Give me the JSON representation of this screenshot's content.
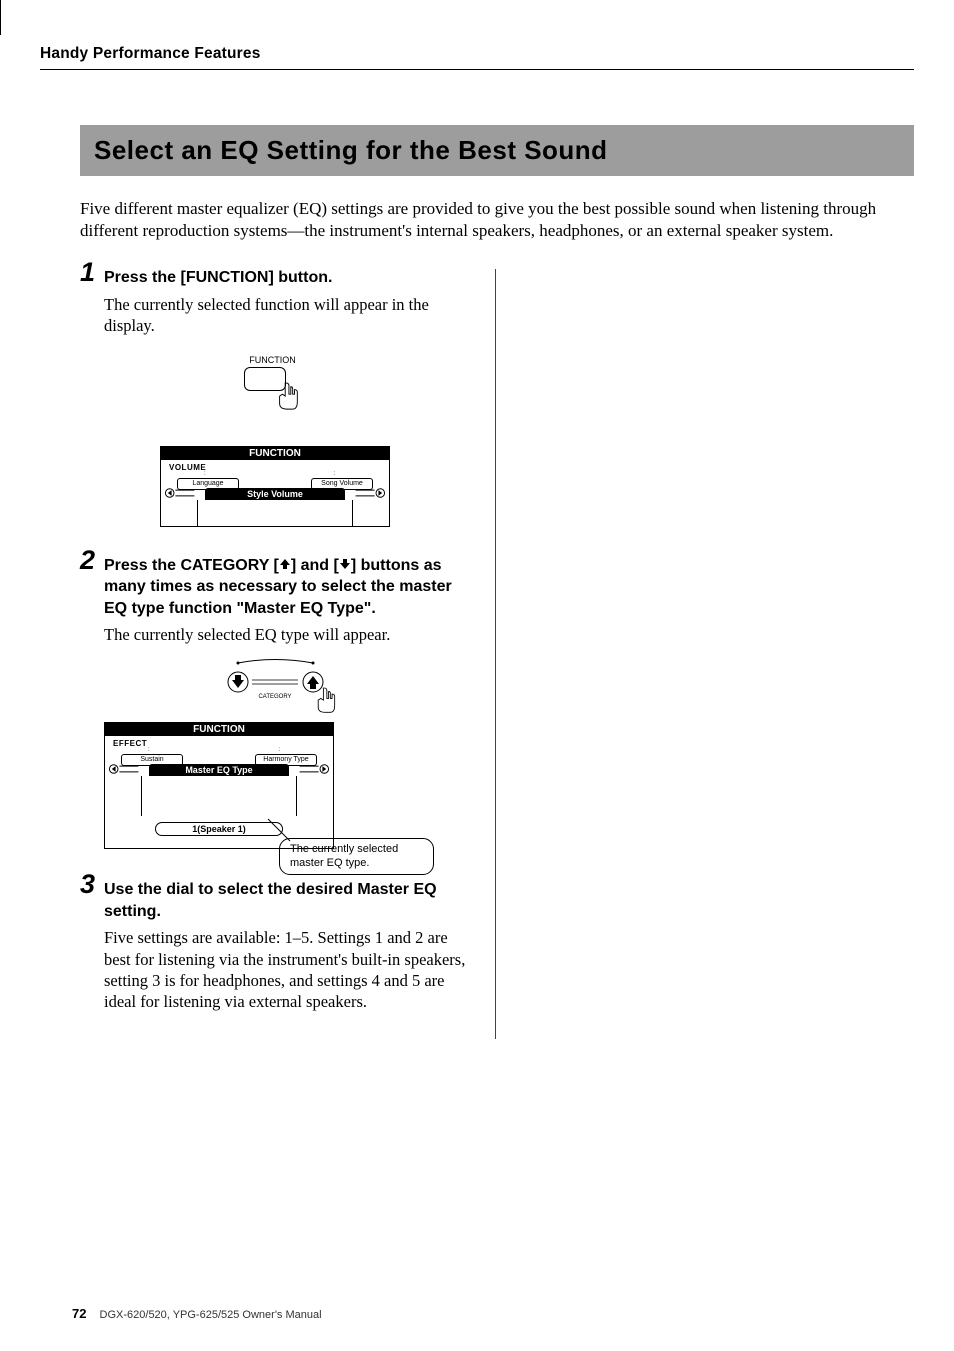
{
  "header": {
    "breadcrumb": "Handy Performance Features"
  },
  "section": {
    "title": "Select an EQ Setting for the Best Sound"
  },
  "intro": "Five different master equalizer (EQ) settings are provided to give you the best possible sound when listening through different reproduction systems—the instrument's internal speakers, headphones, or an external speaker system.",
  "steps": {
    "s1": {
      "num": "1",
      "head": "Press the [FUNCTION] button.",
      "body": "The currently selected function will appear in the display."
    },
    "s2": {
      "num": "2",
      "head_pre": "Press the CATEGORY [",
      "head_mid": "] and [",
      "head_post": "] buttons as many times as necessary to select the master EQ type function \"Master EQ Type\".",
      "body": "The currently selected EQ type will appear."
    },
    "s3": {
      "num": "3",
      "head": "Use the dial to select the desired Master EQ setting.",
      "body": "Five settings are available: 1–5. Settings 1 and 2 are best for listening via the instrument's built-in speakers, setting 3 is for headphones, and settings 4 and 5 are ideal for listening via external speakers."
    }
  },
  "fig1": {
    "func_label": "FUNCTION",
    "lcd_top": "FUNCTION",
    "lcd_title": "VOLUME",
    "chip_left": "Language",
    "chip_right": "Song Volume",
    "big_chip": "Style Volume"
  },
  "fig2": {
    "panel_label": "CATEGORY",
    "lcd_top": "FUNCTION",
    "lcd_title": "EFFECT",
    "chip_left": "Sustain",
    "chip_right": "Harmony Type",
    "big_chip": "Master EQ Type",
    "value_chip": "1(Speaker 1)",
    "callout": "The currently selected master EQ type."
  },
  "footer": {
    "page": "72",
    "text": "DGX-620/520, YPG-625/525  Owner's Manual"
  }
}
